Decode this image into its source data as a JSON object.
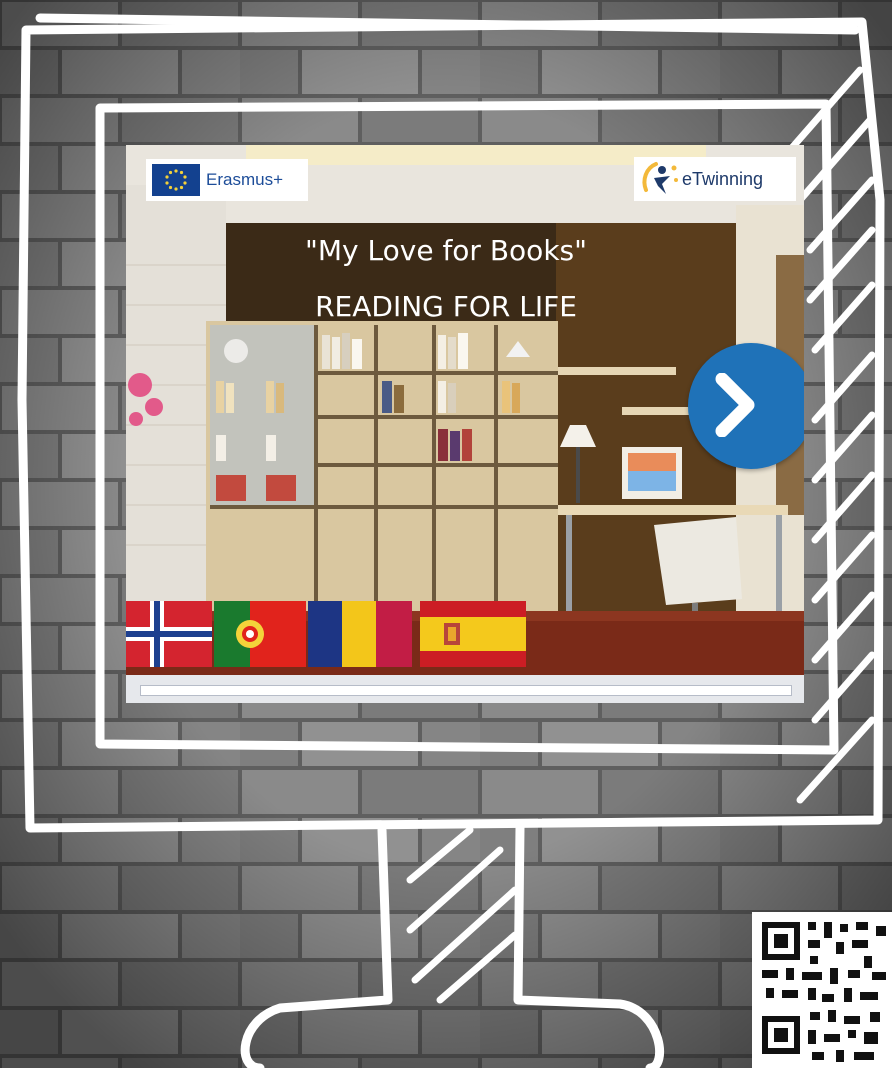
{
  "slide": {
    "logos": {
      "erasmus": "Erasmus+",
      "etwinning": "eTwinning"
    },
    "title_line1": "\"My Love for Books\"",
    "title_line2": "READING FOR LIFE",
    "next_icon": "chevron-right-icon",
    "flags": [
      "Norway",
      "Portugal",
      "Romania",
      "Spain"
    ]
  },
  "colors": {
    "accent": "#1f72b8",
    "erasmus_blue": "#13418f"
  }
}
